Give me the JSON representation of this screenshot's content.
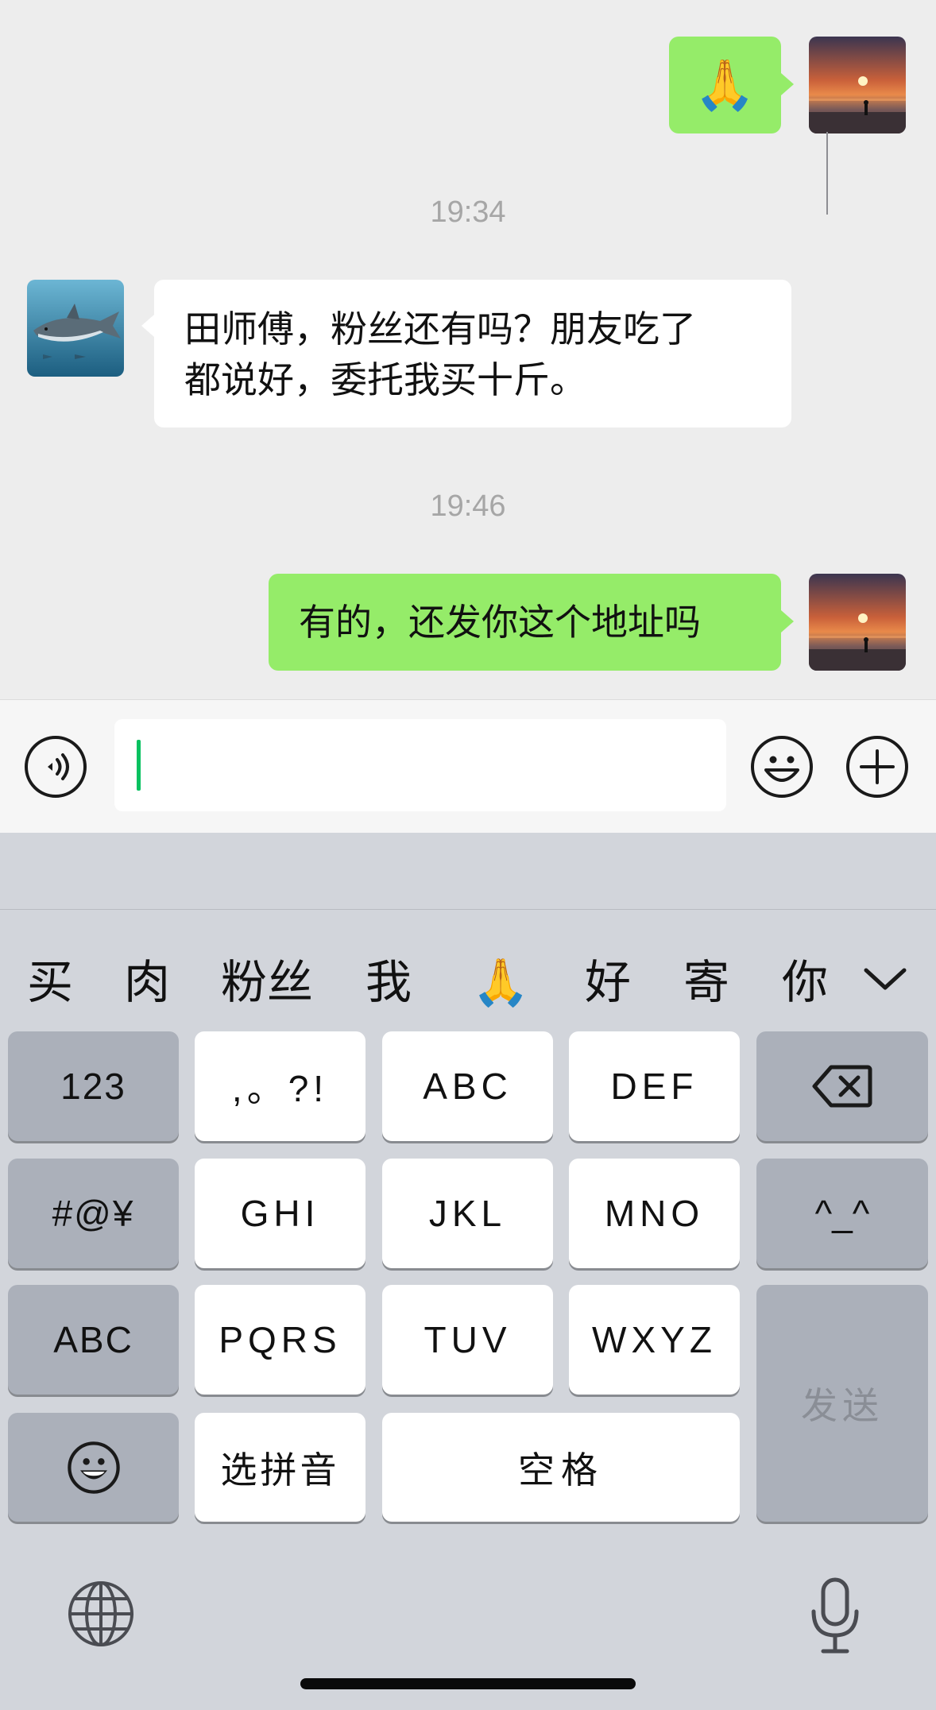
{
  "chat": {
    "messages": [
      {
        "from": "me",
        "text": "🙏"
      },
      {
        "timestamp": "19:34"
      },
      {
        "from": "contact",
        "text_line1": "田师傅，粉丝还有吗？朋友吃了",
        "text_line2": "都说好，委托我买十斤。"
      },
      {
        "timestamp": "19:46"
      },
      {
        "from": "me",
        "text": "有的，还发你这个地址吗"
      }
    ]
  },
  "input_bar": {
    "voice_icon": "voice-icon",
    "text_value": "",
    "emoji_icon": "emoji-icon",
    "plus_icon": "plus-icon"
  },
  "keyboard": {
    "candidates": [
      "买",
      "肉",
      "粉丝",
      "我",
      "🙏",
      "好",
      "寄",
      "你"
    ],
    "expand_icon": "chevron-down-icon",
    "keys": {
      "k123": "123",
      "punct": ",。?!",
      "abc": "ABC",
      "def": "DEF",
      "ghi": "GHI",
      "jkl": "JKL",
      "mno": "MNO",
      "face": "^_^",
      "symbols": "#@¥",
      "pqrs": "PQRS",
      "tuv": "TUV",
      "wxyz": "WXYZ",
      "abc_switch": "ABC",
      "pinyin": "选拼音",
      "space": "空格",
      "send": "发送"
    },
    "backspace_icon": "backspace-icon",
    "emoji_key_icon": "emoji-icon",
    "globe_icon": "globe-icon",
    "mic_icon": "microphone-icon"
  },
  "colors": {
    "outgoing_bubble": "#95ec69",
    "incoming_bubble": "#ffffff",
    "chat_background": "#ededed",
    "keyboard_background": "#d2d5db",
    "caret": "#07c160"
  }
}
